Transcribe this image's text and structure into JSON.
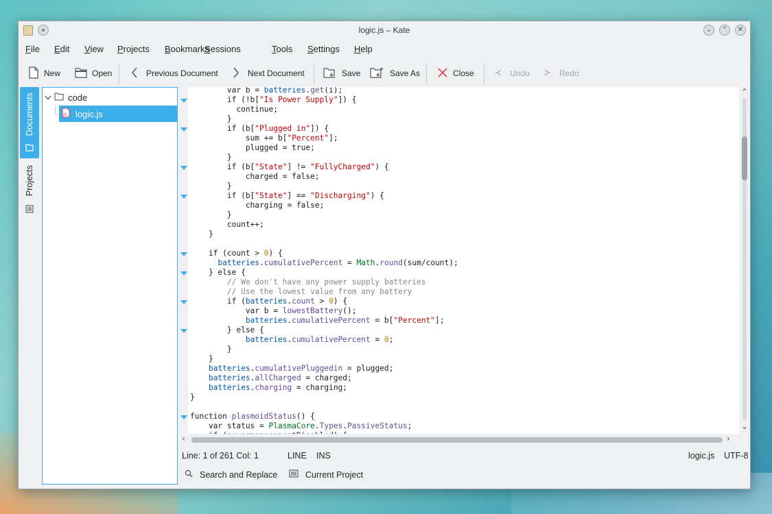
{
  "window": {
    "title": "logic.js – Kate"
  },
  "menu": [
    "File",
    "Edit",
    "View",
    "Projects",
    "Bookmarks",
    "Sessions",
    "Tools",
    "Settings",
    "Help"
  ],
  "menu_mnemonic": [
    "F",
    "E",
    "V",
    "P",
    "B",
    "S",
    "T",
    "S",
    "H"
  ],
  "toolbar": {
    "new": "New",
    "open": "Open",
    "prev": "Previous Document",
    "next": "Next Document",
    "save": "Save",
    "save_as": "Save As",
    "close": "Close",
    "undo": "Undo",
    "redo": "Redo"
  },
  "side_tabs": {
    "documents": "Documents",
    "projects": "Projects"
  },
  "tree": {
    "folder": "code",
    "file": "logic.js"
  },
  "code_lines": [
    "        var b = batteries.get(i);",
    "        if (!b[\"Is Power Supply\"]) {",
    "          continue;",
    "        }",
    "        if (b[\"Plugged in\"]) {",
    "            sum += b[\"Percent\"];",
    "            plugged = true;",
    "        }",
    "        if (b[\"State\"] != \"FullyCharged\") {",
    "            charged = false;",
    "        }",
    "        if (b[\"State\"] == \"Discharging\") {",
    "            charging = false;",
    "        }",
    "        count++;",
    "    }",
    "",
    "    if (count > 0) {",
    "      batteries.cumulativePercent = Math.round(sum/count);",
    "    } else {",
    "        // We don't have any power supply batteries",
    "        // Use the lowest value from any battery",
    "        if (batteries.count > 0) {",
    "            var b = lowestBattery();",
    "            batteries.cumulativePercent = b[\"Percent\"];",
    "        } else {",
    "            batteries.cumulativePercent = 0;",
    "        }",
    "    }",
    "    batteries.cumulativePluggedin = plugged;",
    "    batteries.allCharged = charged;",
    "    batteries.charging = charging;",
    "}",
    "",
    "function plasmoidStatus() {",
    "    var status = PlasmaCore.Types.PassiveStatus;",
    "    if (powermanagementDisabled) {"
  ],
  "status": {
    "position": "Line: 1 of 261 Col: 1",
    "mode": "LINE",
    "input": "INS",
    "filename": "logic.js",
    "encoding": "UTF-8"
  },
  "bottom": {
    "search": "Search and Replace",
    "project": "Current Project"
  },
  "colors": {
    "accent": "#3daee9",
    "close_icon": "#da4453",
    "background": "#eff0f1"
  }
}
